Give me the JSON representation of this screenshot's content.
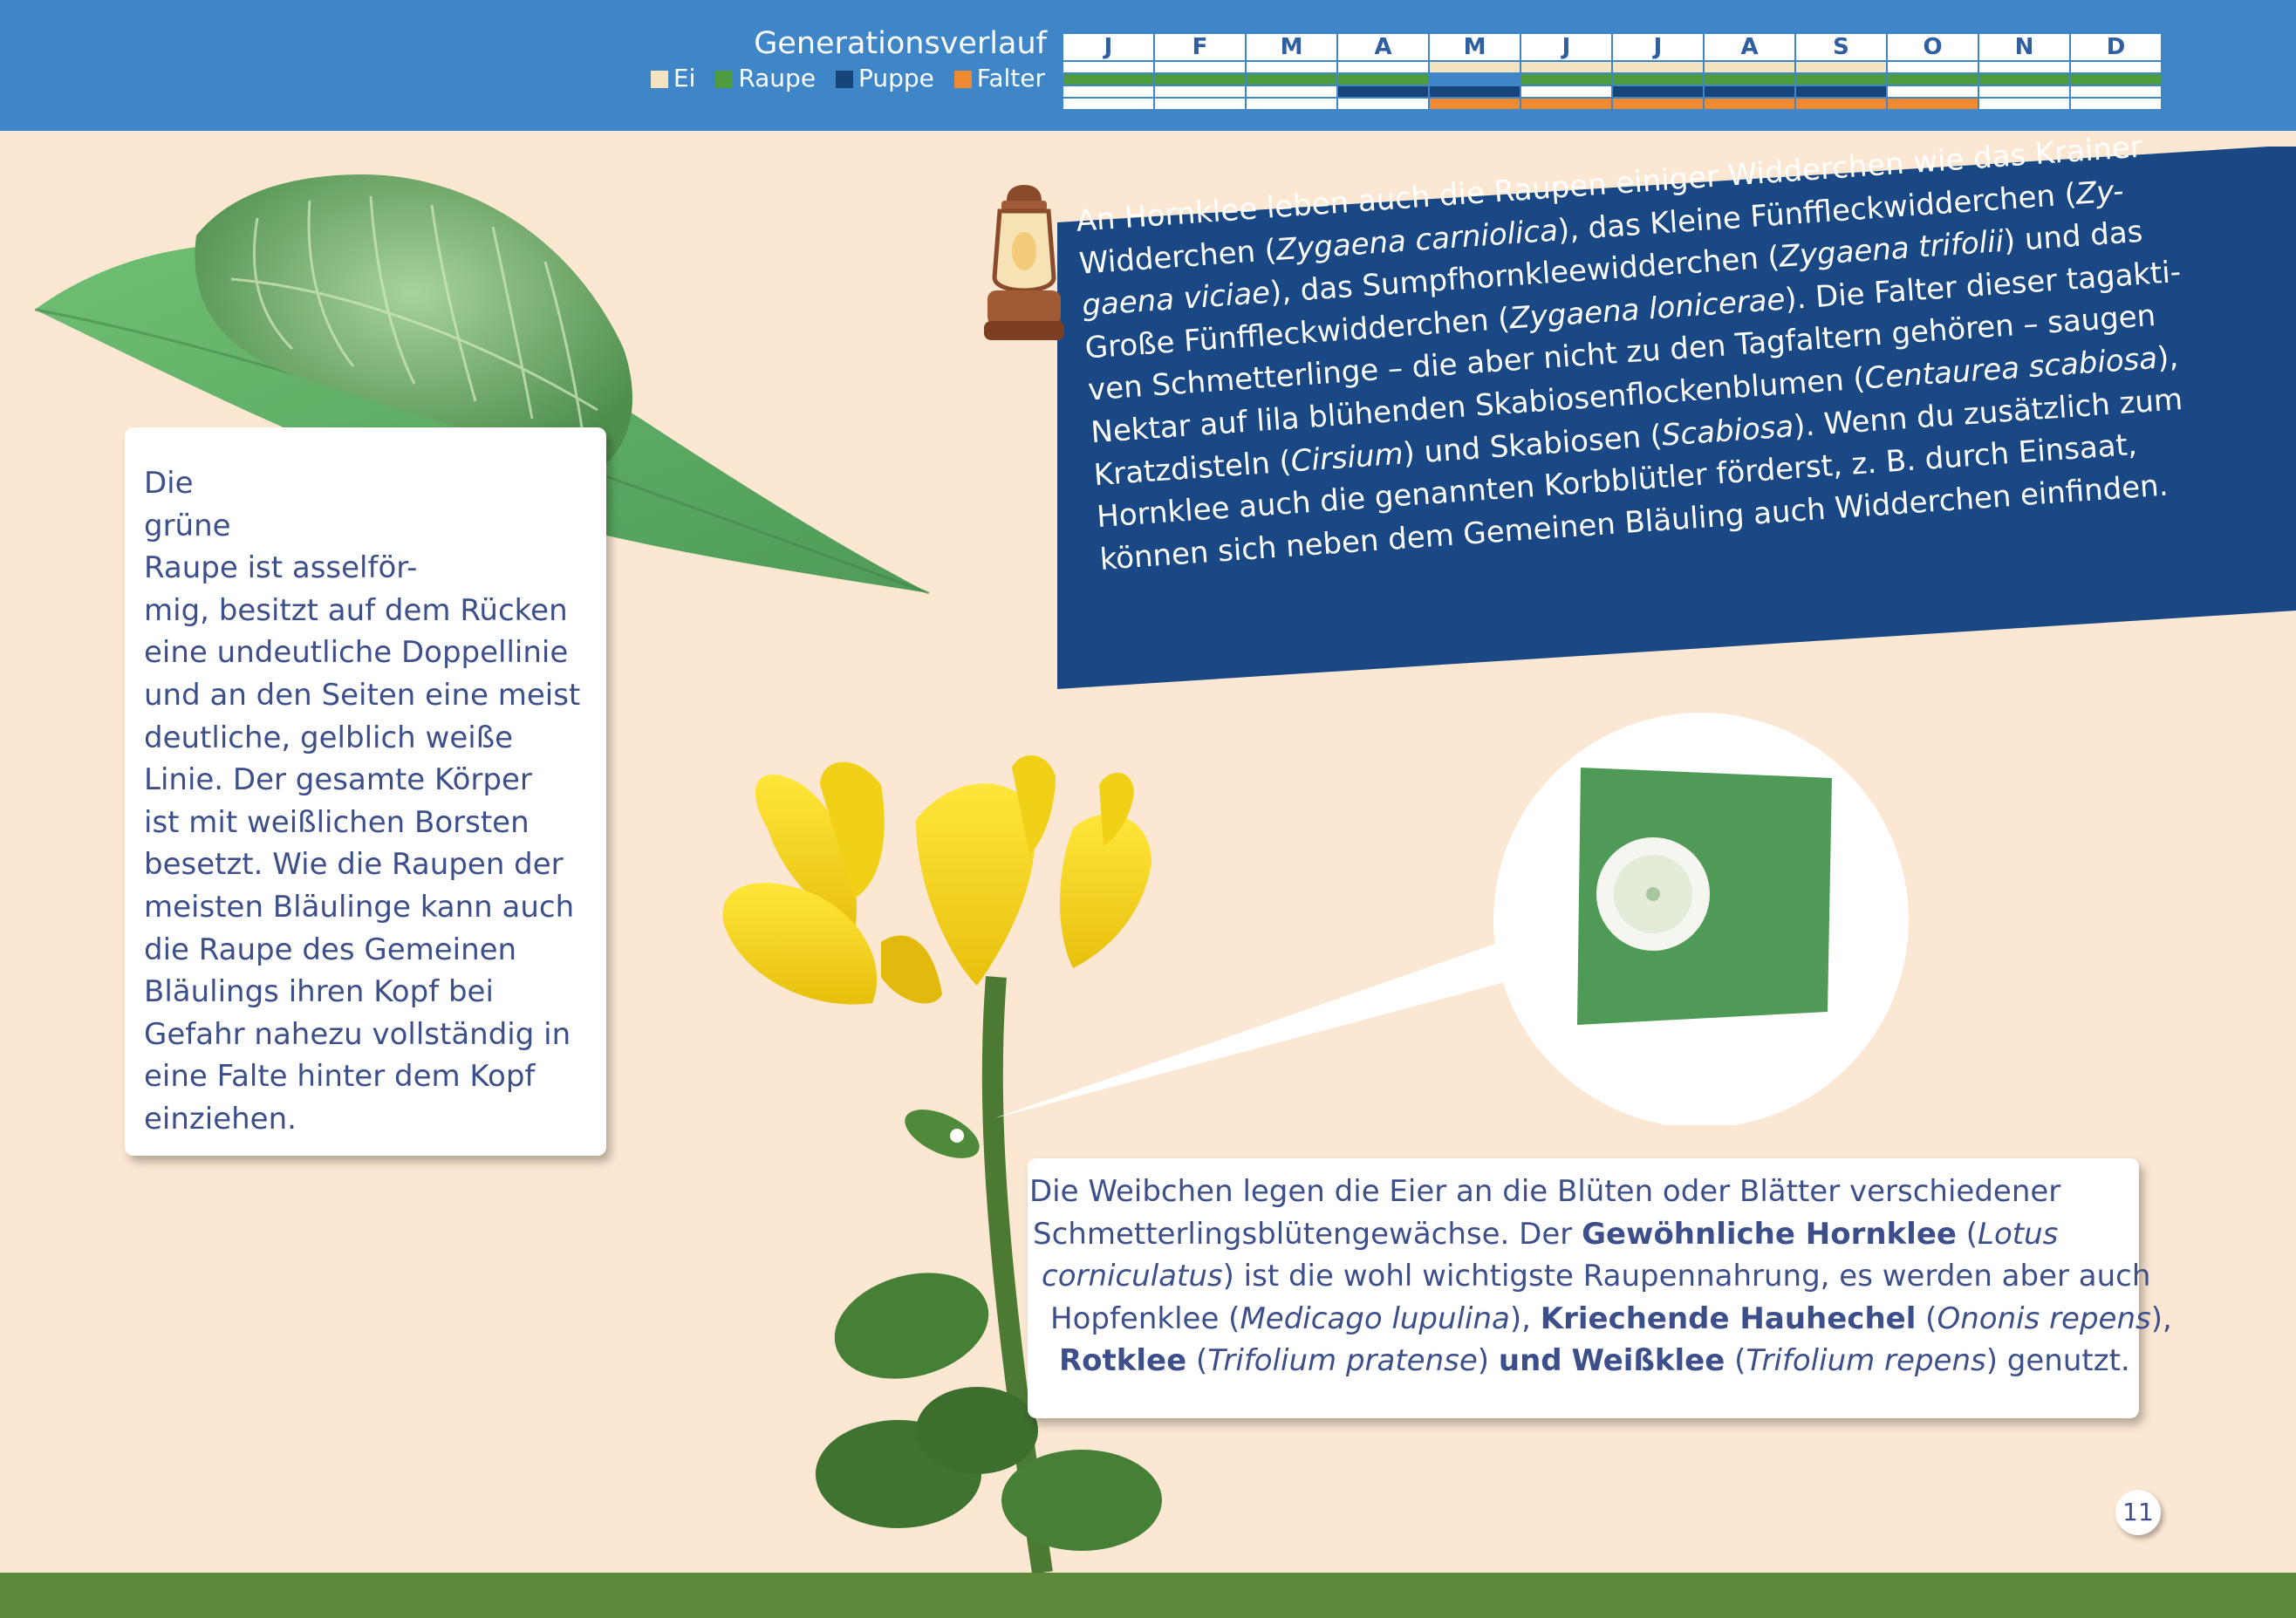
{
  "header": {
    "title": "Generationsverlauf",
    "legend": [
      {
        "label": "Ei",
        "color": "#f3e3bf"
      },
      {
        "label": "Raupe",
        "color": "#4e9a3e"
      },
      {
        "label": "Puppe",
        "color": "#17457a"
      },
      {
        "label": "Falter",
        "color": "#ef8a32"
      }
    ],
    "months": [
      "J",
      "F",
      "M",
      "A",
      "M",
      "J",
      "J",
      "A",
      "S",
      "O",
      "N",
      "D"
    ]
  },
  "caterpillar_text": [
    "Die",
    "grüne",
    "Raupe ist asselför-",
    "mig, besitzt auf dem Rücken",
    "eine undeutliche Doppellinie",
    "und an den Seiten eine meist",
    "deutliche, gelblich weiße",
    "Linie. Der gesamte Körper",
    "ist mit weißlichen Borsten",
    "besetzt. Wie die Raupen der",
    "meisten Bläulinge kann auch",
    "die Raupe des Gemeinen",
    "Bläulings ihren Kopf bei",
    "Gefahr nahezu vollständig in",
    "eine Falte hinter dem Kopf",
    "einziehen."
  ],
  "banner": {
    "l1": "An Hornklee leben auch die Raupen einiger Widderchen wie das Krainer",
    "l2a": "Widderchen (",
    "l2b": "Zygaena carniolica",
    "l2c": "), das Kleine Fünffleckwidderchen (",
    "l2d": "Zy-",
    "l3a": "gaena viciae",
    "l3b": "), das Sumpfhornkleewidderchen (",
    "l3c": "Zygaena trifolii",
    "l3d": ") und das",
    "l4a": "Große Fünffleckwidderchen (",
    "l4b": "Zygaena lonicerae",
    "l4c": "). Die Falter dieser tagakti-",
    "l5": "ven Schmetterlinge – die aber nicht zu den Tagfaltern gehören – saugen",
    "l6a": "Nektar auf lila blühenden Skabiosenflockenblumen (",
    "l6b": "Centaurea scabiosa",
    "l6c": "),",
    "l7a": "Kratzdisteln (",
    "l7b": "Cirsium",
    "l7c": ") und Skabiosen (",
    "l7d": "Scabiosa",
    "l7e": "). Wenn du zusätzlich zum",
    "l8": "Hornklee auch die genannten Korbblütler förderst, z. B. durch Einsaat,",
    "l9": "können sich neben dem Gemeinen Bläuling auch Widderchen einfinden."
  },
  "eggs": {
    "l1": "Die Weibchen legen die Eier an die Blüten oder Blätter verschiedener",
    "l2a": "Schmetterlingsblütengewächse. Der ",
    "l2b": "Gewöhnliche Hornklee",
    "l2c": " (",
    "l2d": "Lotus",
    "l3a": "corniculatus",
    "l3b": ") ist die wohl wichtigste Raupennahrung, es werden aber auch",
    "l4a": "Hopfenklee (",
    "l4b": "Medicago lupulina",
    "l4c": "), ",
    "l4d": "Kriechende Hauhechel",
    "l4e": " (",
    "l4f": "Ononis repens",
    "l4g": "),",
    "l5a": "Rotklee",
    "l5b": " (",
    "l5c": "Trifolium pratense",
    "l5d": ") ",
    "l5e": "und",
    "l5f": " ",
    "l5g": "Weißklee",
    "l5h": " (",
    "l5i": "Trifolium repens",
    "l5j": ") genutzt."
  },
  "page_number": "11"
}
